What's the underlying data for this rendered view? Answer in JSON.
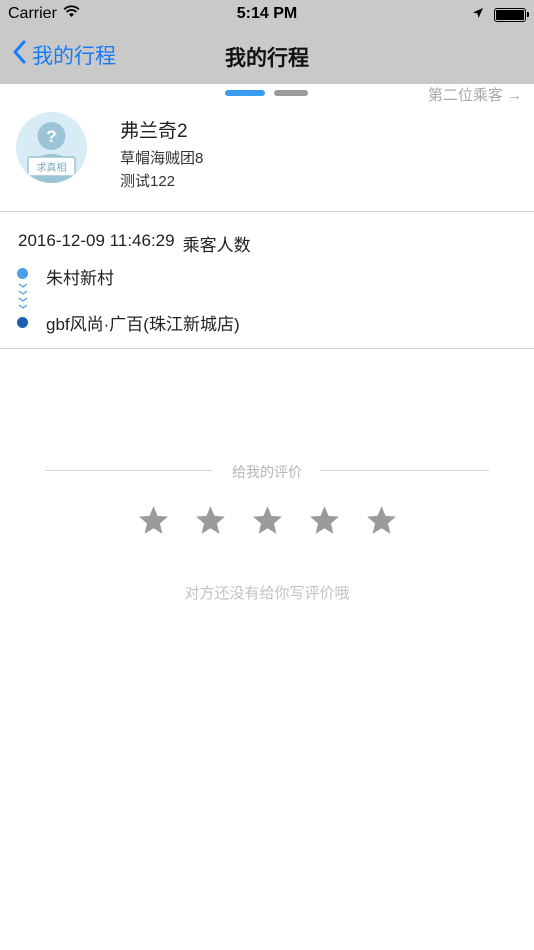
{
  "status_bar": {
    "carrier": "Carrier",
    "time": "5:14 PM"
  },
  "nav": {
    "back_label": "我的行程",
    "title": "我的行程"
  },
  "pager": {
    "next_passenger": "第二位乘客 →",
    "active_index": 0,
    "page_count": 2
  },
  "passenger": {
    "name": "弗兰奇2",
    "team": "草帽海贼团8",
    "note": "测试122",
    "avatar_sign": "求真相"
  },
  "trip": {
    "datetime": "2016-12-09 11:46:29",
    "passenger_count_label": "乘客人数",
    "start": "朱村新村",
    "end": "gbf风尚·广百(珠江新城店)"
  },
  "rating": {
    "label": "给我的评价",
    "stars": [
      {
        "icon": "star-icon"
      },
      {
        "icon": "star-icon"
      },
      {
        "icon": "star-icon"
      },
      {
        "icon": "star-icon"
      },
      {
        "icon": "star-icon"
      }
    ],
    "empty_message": "对方还没有给你写评价哦"
  },
  "colors": {
    "accent": "#1a7cf5",
    "pager_active": "#3a9bf0",
    "star": "#9b9b9b",
    "divider": "#c9dbe6"
  }
}
